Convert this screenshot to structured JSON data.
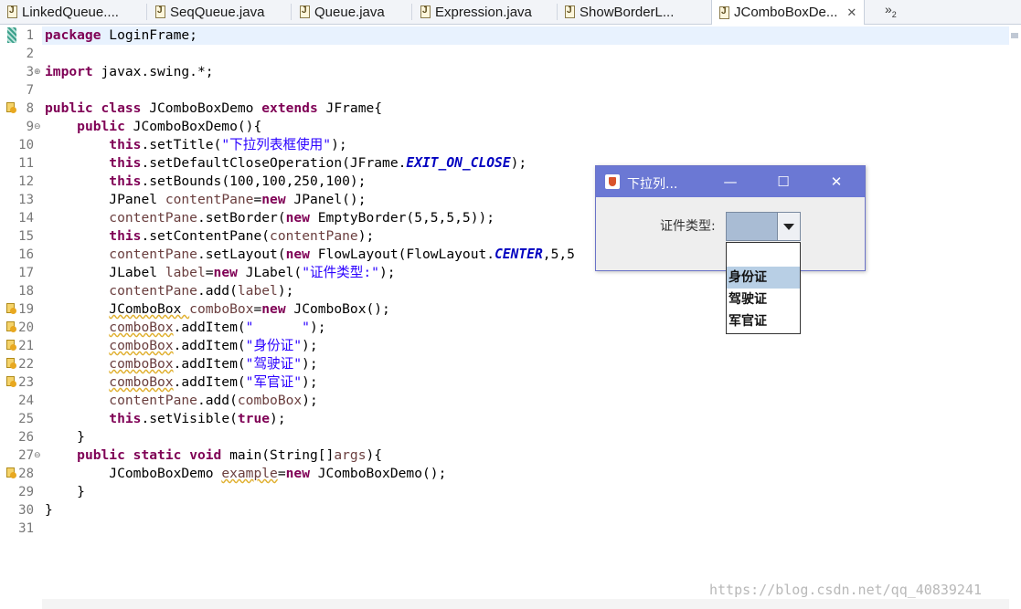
{
  "tabs": [
    {
      "label": "LinkedQueue....",
      "active": false
    },
    {
      "label": "SeqQueue.java",
      "active": false
    },
    {
      "label": "Queue.java",
      "active": false
    },
    {
      "label": "Expression.java",
      "active": false
    },
    {
      "label": "ShowBorderL...",
      "active": false
    },
    {
      "label": "JComboBoxDe...",
      "active": true
    }
  ],
  "tab_overflow": {
    "symbol": "»",
    "count": "2"
  },
  "editor": {
    "lines": [
      {
        "n": "1"
      },
      {
        "n": "2"
      },
      {
        "n": "3"
      },
      {
        "n": "7"
      },
      {
        "n": "8"
      },
      {
        "n": "9"
      },
      {
        "n": "10"
      },
      {
        "n": "11"
      },
      {
        "n": "12"
      },
      {
        "n": "13"
      },
      {
        "n": "14"
      },
      {
        "n": "15"
      },
      {
        "n": "16"
      },
      {
        "n": "17"
      },
      {
        "n": "18"
      },
      {
        "n": "19"
      },
      {
        "n": "20"
      },
      {
        "n": "21"
      },
      {
        "n": "22"
      },
      {
        "n": "23"
      },
      {
        "n": "24"
      },
      {
        "n": "25"
      },
      {
        "n": "26"
      },
      {
        "n": "27"
      },
      {
        "n": "28"
      },
      {
        "n": "29"
      },
      {
        "n": "30"
      },
      {
        "n": "31"
      }
    ],
    "code": {
      "package": "package",
      "package_name": " LoginFrame;",
      "import": "import",
      "import_name": " javax.swing.*;",
      "public": "public",
      "class": "class",
      "extends": "extends",
      "class_name": " JComboBoxDemo ",
      "super_name": " JFrame{",
      "ctor": " JComboBoxDemo(){",
      "this": "this",
      "new": "new",
      "true": "true",
      "static": "static",
      "void": "void",
      "setTitle": ".setTitle(",
      "title_str": "\"下拉列表框使用\"",
      "close_end": ");",
      "setDefault": ".setDefaultCloseOperation(JFrame.",
      "exit_on_close": "EXIT_ON_CLOSE",
      "setBounds": ".setBounds(100,100,250,100);",
      "jpanel_decl": "JPanel ",
      "contentPane": "contentPane",
      "jpanel_new": " JPanel();",
      "setBorder": ".setBorder(",
      "emptyBorder": " EmptyBorder(5,5,5,5));",
      "setContentPane": ".setContentPane(",
      "setLayout": ".setLayout(",
      "flowLayout": " FlowLayout(FlowLayout.",
      "center": "CENTER",
      "flow_end": ",5,5",
      "jlabel_decl": "JLabel ",
      "label": "label",
      "jlabel_new": " JLabel(",
      "label_str": "\"证件类型:\"",
      "add": ".add(",
      "jcombo_decl": "JComboBox ",
      "comboBox": "comboBox",
      "jcombo_new": " JComboBox();",
      "addItem": ".addItem(",
      "blank_str": "\"      \"",
      "id_str": "\"身份证\"",
      "license_str": "\"驾驶证\"",
      "officer_str": "\"军官证\"",
      "setVisible": ".setVisible(",
      "close_brace": "}",
      "main_sig": " main(String[]",
      "args": "args",
      "main_end": "){",
      "demo_decl": "JComboBoxDemo ",
      "example": "example",
      "demo_new": " JComboBoxDemo();"
    }
  },
  "swing_window": {
    "title": "下拉列...",
    "minimize": "—",
    "maximize": "☐",
    "close": "✕",
    "label": "证件类型:",
    "combo_selected": "",
    "options": [
      "",
      "身份证",
      "驾驶证",
      "军官证"
    ],
    "highlighted_option": "身份证"
  },
  "watermark": "https://blog.csdn.net/qq_40839241"
}
